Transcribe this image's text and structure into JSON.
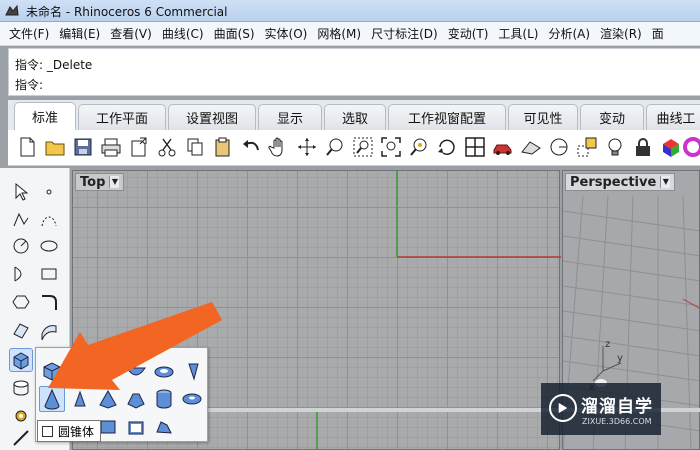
{
  "window": {
    "title": "未命名 - Rhinoceros 6 Commercial"
  },
  "menu": [
    "文件(F)",
    "编辑(E)",
    "查看(V)",
    "曲线(C)",
    "曲面(S)",
    "实体(O)",
    "网格(M)",
    "尺寸标注(D)",
    "变动(T)",
    "工具(L)",
    "分析(A)",
    "渲染(R)",
    "面"
  ],
  "command": {
    "history": "指令: _Delete",
    "prompt": "指令:"
  },
  "tabs": [
    "标准",
    "工作平面",
    "设置视图",
    "显示",
    "选取",
    "工作视窗配置",
    "可见性",
    "变动",
    "曲线工"
  ],
  "toolbar_icons": [
    "new-file-icon",
    "open-folder-icon",
    "save-icon",
    "print-icon",
    "import-icon",
    "cut-icon",
    "copy-icon",
    "paste-icon",
    "undo-icon",
    "pan-hand-icon",
    "rotate-view-icon",
    "zoom-icon",
    "zoom-window-icon",
    "zoom-extents-icon",
    "zoom-selected-icon",
    "rotate-camera-icon",
    "four-viewports-icon",
    "car-icon",
    "perspective-plane-icon",
    "select-icon",
    "object-snap-icon",
    "light-bulb-icon",
    "lock-icon",
    "materials-icon",
    "color-wheel-icon"
  ],
  "viewports": {
    "top": "Top",
    "perspective": "Perspective",
    "dropdown_glyph": "▼"
  },
  "tooltip": {
    "text": "圆锥体"
  },
  "watermark": {
    "title": "溜溜自学",
    "subtitle": "ZIXUE.3D66.COM"
  },
  "colors": {
    "arrow": "#f26522",
    "x_axis": "#b23a2e",
    "y_axis": "#3a9a3a",
    "viewport_bg": "#a8aaac"
  }
}
